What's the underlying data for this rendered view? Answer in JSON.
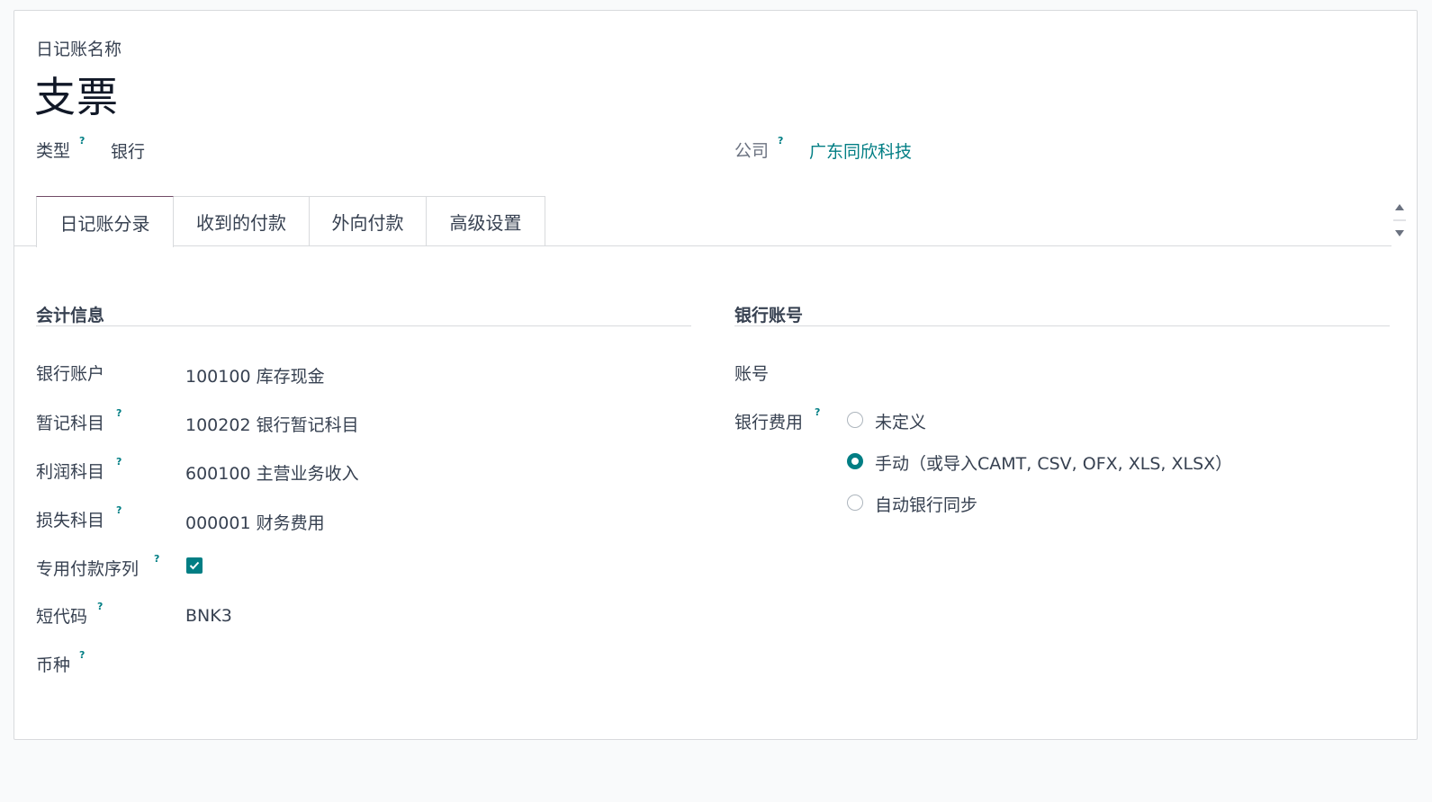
{
  "header": {
    "title_field_label": "日记账名称",
    "title": "支票"
  },
  "top_fields": {
    "type_label": "类型",
    "type_value": "银行",
    "company_label": "公司",
    "company_value": "广东同欣科技",
    "help_mark": "?"
  },
  "tabs": [
    {
      "label": "日记账分录",
      "active": true
    },
    {
      "label": "收到的付款",
      "active": false
    },
    {
      "label": "外向付款",
      "active": false
    },
    {
      "label": "高级设置",
      "active": false
    }
  ],
  "accounting": {
    "section_title": "会计信息",
    "rows": [
      {
        "label": "银行账户",
        "value": "100100 库存现金"
      },
      {
        "label": "暂记科目",
        "value": "100202 银行暂记科目"
      },
      {
        "label": "利润科目",
        "value": "600100 主营业务收入"
      },
      {
        "label": "损失科目",
        "value": "000001 财务费用"
      },
      {
        "label": "专用付款序列",
        "value": "",
        "checked": true
      },
      {
        "label": "短代码",
        "value": "BNK3"
      },
      {
        "label": "币种",
        "value": ""
      }
    ]
  },
  "bank": {
    "section_title": "银行账号",
    "account_label": "账号",
    "account_value": "",
    "feeds_label": "银行费用",
    "feeds_options": [
      {
        "label": "未定义",
        "selected": false
      },
      {
        "label": "手动（或导入CAMT, CSV, OFX, XLS, XLSX）",
        "selected": true
      },
      {
        "label": "自动银行同步",
        "selected": false
      }
    ]
  },
  "colors": {
    "accent": "#017e84",
    "active_tab_border": "#714b67",
    "border": "#d8dadd"
  }
}
